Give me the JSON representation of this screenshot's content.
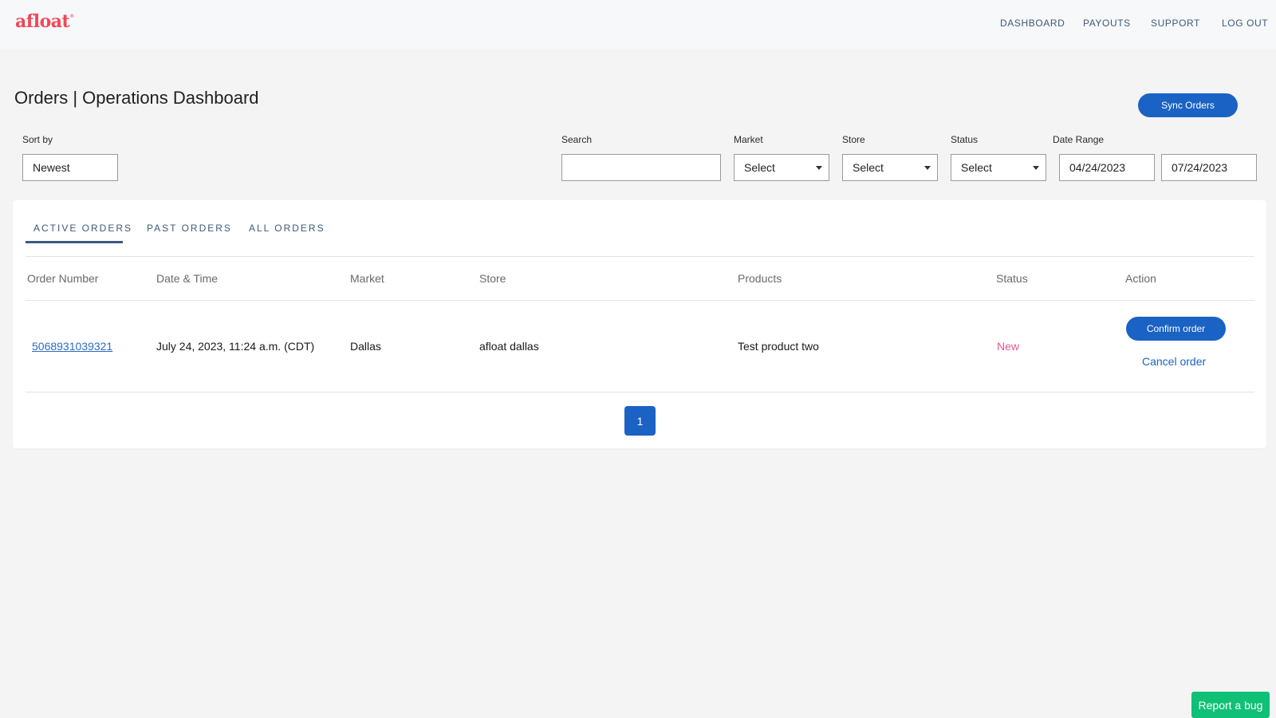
{
  "header": {
    "logo": "afloat",
    "logo_mark": "®",
    "nav": [
      {
        "label": "DASHBOARD"
      },
      {
        "label": "PAYOUTS"
      },
      {
        "label": "SUPPORT"
      },
      {
        "label": "LOG OUT"
      }
    ]
  },
  "page": {
    "title": "Orders | Operations Dashboard",
    "sync_label": "Sync Orders"
  },
  "filters": {
    "sort_label": "Sort by",
    "sort_value": "Newest",
    "search_label": "Search",
    "search_value": "",
    "market_label": "Market",
    "market_value": "Select",
    "store_label": "Store",
    "store_value": "Select",
    "status_label": "Status",
    "status_value": "Select",
    "date_label": "Date Range",
    "date_from": "04/24/2023",
    "date_to": "07/24/2023"
  },
  "tabs": [
    {
      "label": "ACTIVE ORDERS",
      "active": true
    },
    {
      "label": "PAST ORDERS",
      "active": false
    },
    {
      "label": "ALL ORDERS",
      "active": false
    }
  ],
  "table": {
    "columns": [
      "Order Number",
      "Date & Time",
      "Market",
      "Store",
      "Products",
      "Status",
      "Action"
    ],
    "rows": [
      {
        "order_number": "5068931039321",
        "date_time": "July 24, 2023, 11:24 a.m. (CDT)",
        "market": "Dallas",
        "store": "afloat dallas",
        "products": "Test product two",
        "status": "New",
        "confirm_label": "Confirm order",
        "cancel_label": "Cancel order"
      }
    ]
  },
  "pagination": {
    "current_page": "1"
  },
  "report_bug_label": "Report a bug",
  "colors": {
    "brand": "#f0475a",
    "primary": "#1a62c4",
    "status_new": "#e8569a",
    "report_bug": "#10c076"
  }
}
